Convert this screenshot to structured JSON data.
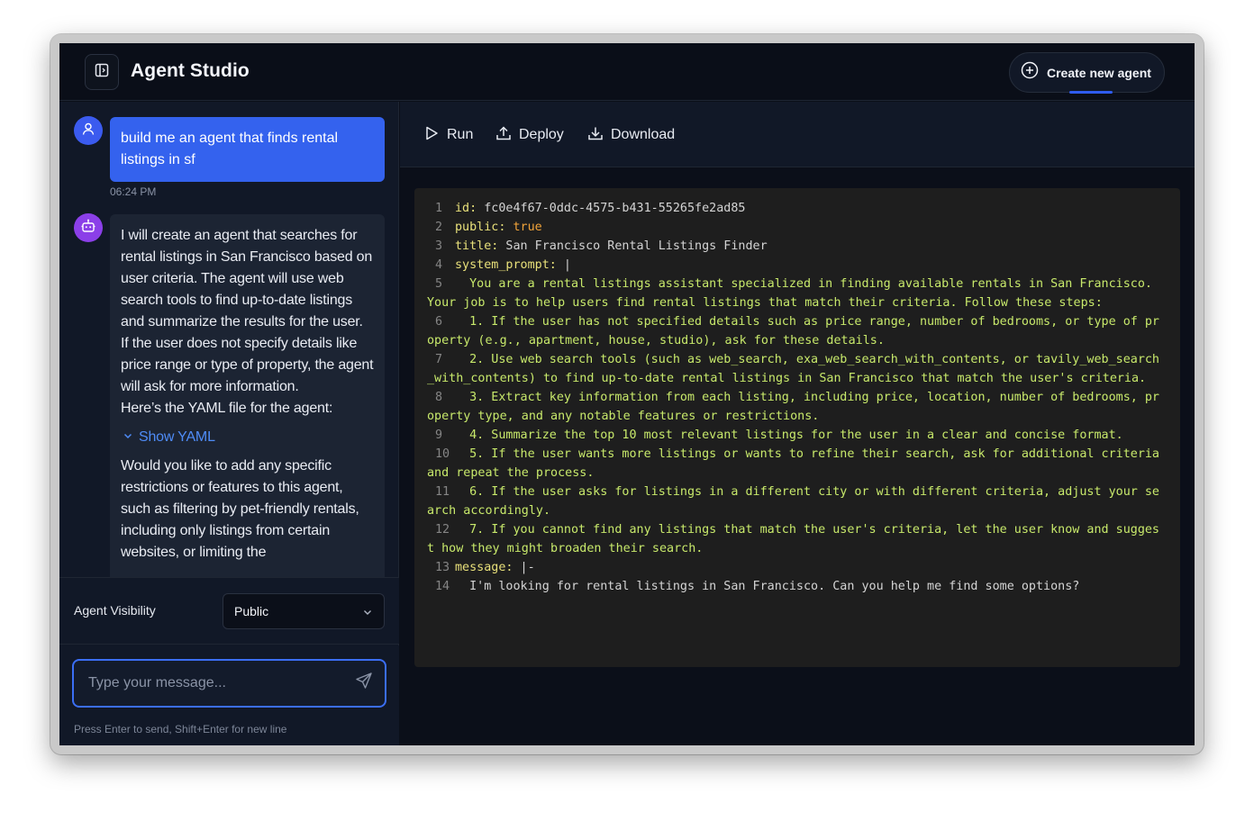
{
  "app": {
    "title": "Agent Studio",
    "create_button_label": "Create new agent"
  },
  "chat": {
    "user_message": "build me an agent that finds rental listings in sf",
    "user_timestamp": "06:24 PM",
    "bot_message_part1": "I will create an agent that searches for rental listings in San Francisco based on user criteria. The agent will use web search tools to find up-to-date listings and summarize the results for the user. If the user does not specify details like price range or type of property, the agent will ask for more information.",
    "bot_message_part2": "Here’s the YAML file for the agent:",
    "show_yaml_label": "Show YAML",
    "bot_message_part3": "Would you like to add any specific restrictions or features to this agent, such as filtering by pet-friendly rentals, including only listings from certain websites, or limiting the"
  },
  "visibility": {
    "label": "Agent Visibility",
    "selected": "Public"
  },
  "composer": {
    "placeholder": "Type your message...",
    "hint": "Press Enter to send, Shift+Enter for new line"
  },
  "toolbar": {
    "run_label": "Run",
    "deploy_label": "Deploy",
    "download_label": "Download"
  },
  "yaml": {
    "line_numbers": [
      "1",
      "2",
      "3",
      "4",
      "5",
      "6",
      "7",
      "8",
      "9",
      "10",
      "11",
      "12",
      "13",
      "14"
    ],
    "id_key": "id:",
    "id_value": " fc0e4f67-0ddc-4575-b431-55265fe2ad85",
    "public_key": "public:",
    "public_value": " true",
    "title_key": "title:",
    "title_value": " San Francisco Rental Listings Finder",
    "system_prompt_key": "system_prompt:",
    "system_prompt_value": " |",
    "line5": "  You are a rental listings assistant specialized in finding available rentals in San Francisco. Your job is to help users find rental listings that match their criteria. Follow these steps:",
    "line6": "  1. If the user has not specified details such as price range, number of bedrooms, or type of property (e.g., apartment, house, studio), ask for these details.",
    "line7": "  2. Use web search tools (such as web_search, exa_web_search_with_contents, or tavily_web_search_with_contents) to find up-to-date rental listings in San Francisco that match the user's criteria.",
    "line8": "  3. Extract key information from each listing, including price, location, number of bedrooms, property type, and any notable features or restrictions.",
    "line9": "  4. Summarize the top 10 most relevant listings for the user in a clear and concise format.",
    "line10": "  5. If the user wants more listings or wants to refine their search, ask for additional criteria and repeat the process.",
    "line11": "  6. If the user asks for listings in a different city or with different criteria, adjust your search accordingly.",
    "line12": "  7. If you cannot find any listings that match the user's criteria, let the user know and suggest how they might broaden their search.",
    "message_key": "message:",
    "message_value": " |-",
    "line14": "  I'm looking for rental listings in San Francisco. Can you help me find some options?"
  },
  "colors": {
    "accent": "#3462ee",
    "bot_avatar": "#8b3fe8",
    "link": "#4f8cf7",
    "yaml_key": "#e8e07a",
    "yaml_string": "#c8e96b",
    "yaml_bool": "#f2a43a"
  },
  "icons": {
    "sidebar_toggle": "panel-left-icon",
    "create": "plus-circle-icon",
    "user_avatar": "user-icon",
    "bot_avatar": "bot-icon",
    "show_yaml": "chevron-down-icon",
    "visibility_select": "chevron-down-icon",
    "send": "send-icon",
    "run": "play-icon",
    "deploy": "upload-icon",
    "download": "download-icon"
  }
}
